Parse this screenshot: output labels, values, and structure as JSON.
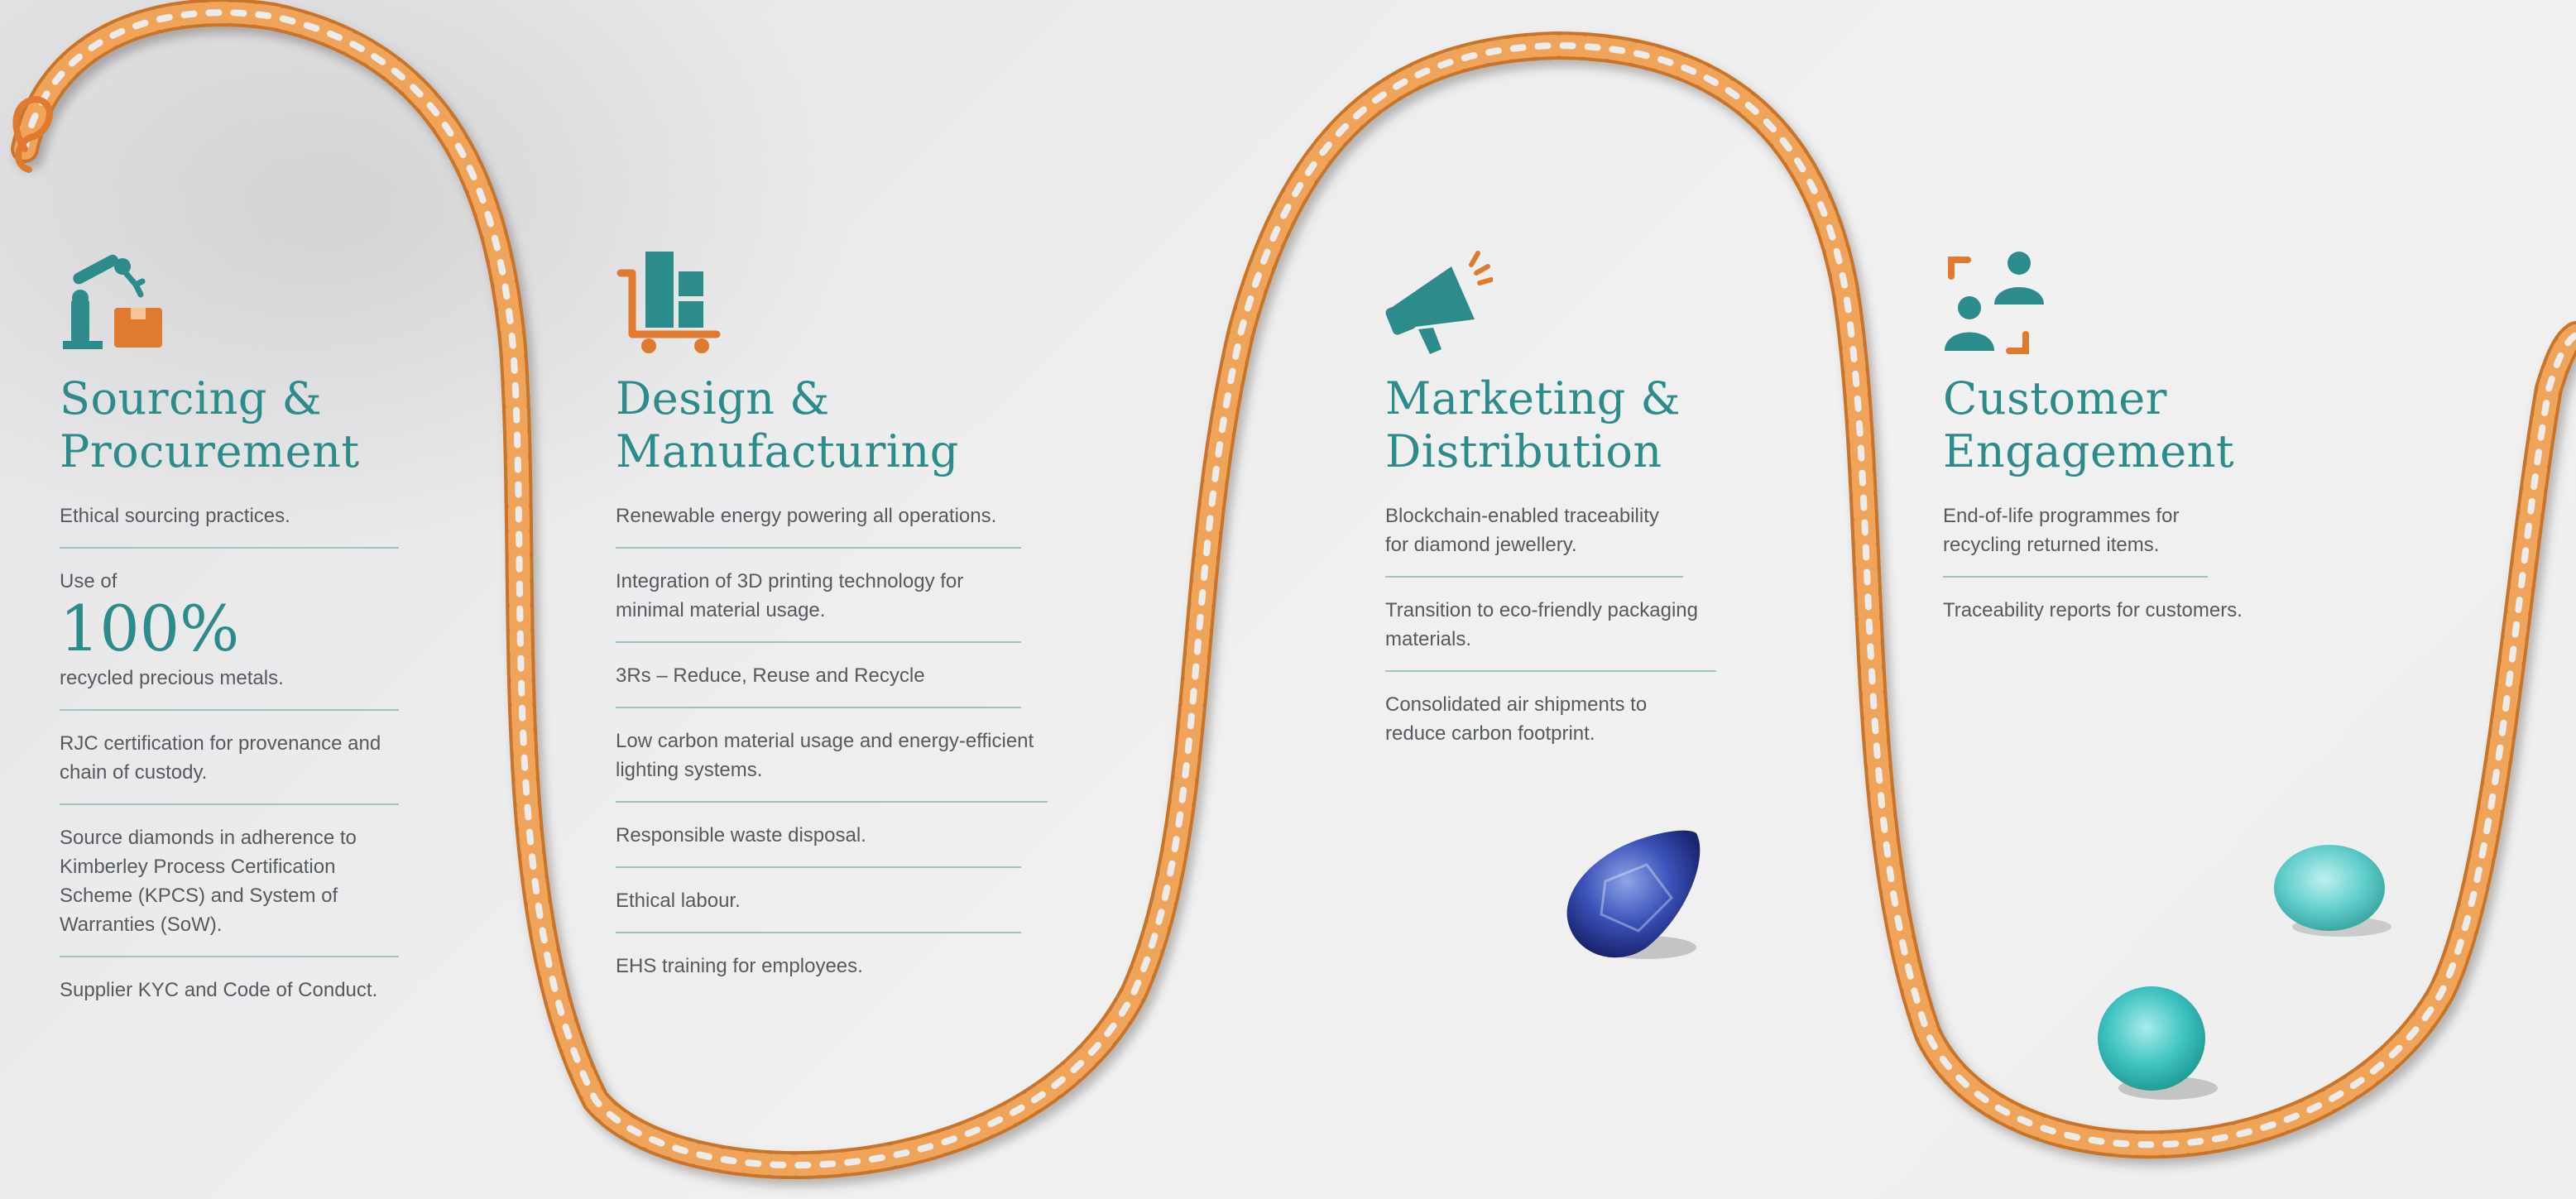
{
  "colors": {
    "teal": "#2c8b8b",
    "orange": "#e07a2f",
    "text": "#555a5e",
    "divider": "#9cc4c4",
    "chain": "#e39140"
  },
  "columns": [
    {
      "icon": "robot-arm-box-icon",
      "title_line1": "Sourcing &",
      "title_line2": "Procurement",
      "items": [
        "Ethical sourcing practices.",
        {
          "prefix": "Use of",
          "number": "100%",
          "suffix": "recycled precious metals."
        },
        "RJC certification for provenance and chain of custody.",
        "Source diamonds in adherence to Kimberley Process Certification Scheme (KPCS) and System of Warranties (SoW).",
        "Supplier KYC and Code of Conduct."
      ]
    },
    {
      "icon": "factory-cart-icon",
      "title_line1": "Design &",
      "title_line2": "Manufacturing",
      "items": [
        "Renewable energy powering all operations.",
        "Integration of 3D printing technology for minimal material usage.",
        "3Rs – Reduce, Reuse and Recycle",
        "Low carbon material usage and energy-efficient lighting systems.",
        "Responsible waste disposal.",
        "Ethical labour.",
        "EHS training for employees."
      ]
    },
    {
      "icon": "megaphone-icon",
      "title_line1": "Marketing &",
      "title_line2": "Distribution",
      "items": [
        "Blockchain-enabled traceability for diamond jewellery.",
        "Transition to eco-friendly packaging materials.",
        "Consolidated air shipments to reduce carbon footprint."
      ]
    },
    {
      "icon": "people-exchange-icon",
      "title_line1": "Customer",
      "title_line2": "Engagement",
      "items": [
        "End-of-life programmes for recycling returned items.",
        "Traceability reports for customers."
      ]
    }
  ]
}
